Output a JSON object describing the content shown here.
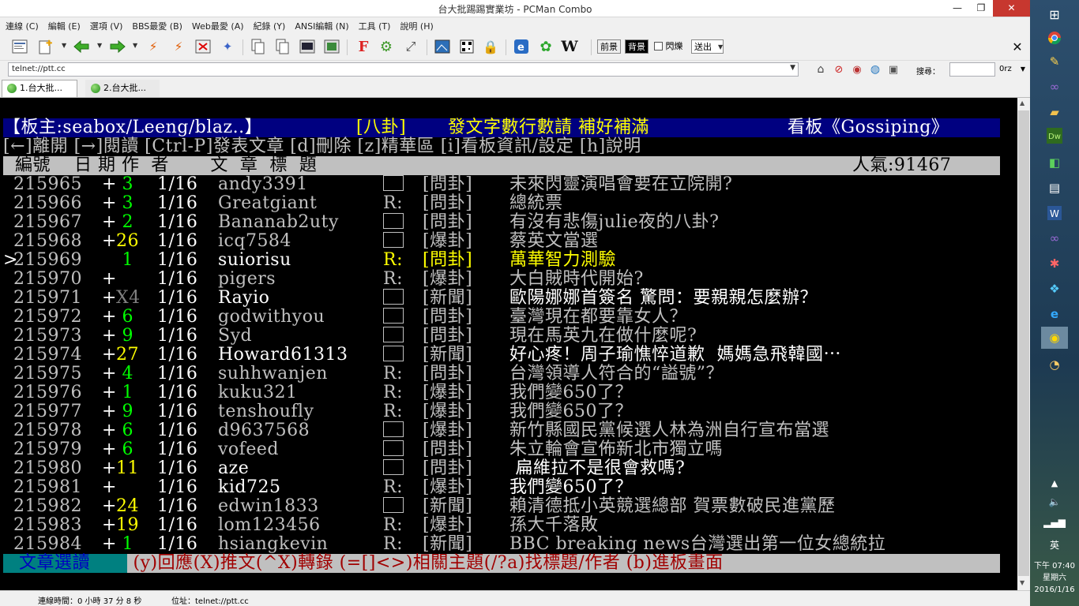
{
  "window": {
    "title": "台大批踢踢實業坊 - PCMan Combo",
    "min": "—",
    "max": "❐",
    "close": "✕"
  },
  "menu": [
    "連線 (C)",
    "編輯 (E)",
    "選項 (V)",
    "BBS最愛 (B)",
    "Web最愛 (A)",
    "紀錄 (Y)",
    "ANSI編輯 (N)",
    "工具 (T)",
    "說明 (H)"
  ],
  "toolbar": {
    "fg": "前景",
    "bg": "背景",
    "blink": "閃爍",
    "send": "送出",
    "close": "✕",
    "icons": [
      "new-connection-icon",
      "add-favorite-icon",
      "back-icon",
      "forward-icon",
      "reconnect-icon",
      "disconnect-icon",
      "close-connection-icon",
      "pin-icon",
      "copy-icon",
      "paste-icon",
      "copy-ansi-icon",
      "screenshot-icon",
      "font-icon",
      "settings-icon",
      "fullscreen-icon",
      "image-icon",
      "qrcode-icon",
      "lock-icon",
      "ie-icon",
      "flower-icon",
      "wikipedia-icon"
    ],
    "wiki": "W",
    "font": "F"
  },
  "address": {
    "value": "telnet://ptt.cc",
    "search_label": "搜尋：",
    "search_engine": "0rz"
  },
  "tabs": [
    {
      "label": "1.台大批..."
    },
    {
      "label": "2.台大批..."
    }
  ],
  "terminal": {
    "header": {
      "left": "【板主:seabox/Leeng/blaz..】",
      "board": "[八卦]",
      "title": "發文字數行數請 補好補滿",
      "right": "看板《Gossiping》"
    },
    "help": "[←]離開 [→]閱讀 [Ctrl-P]發表文章 [d]刪除 [z]精華區 [i]看板資訊/設定 [h]說明",
    "colhead": {
      "cols": "  編號    日 期 作  者       文  章  標  題",
      "popularity": "人氣:91467"
    },
    "rows": [
      {
        "cur": " ",
        "num": "215965",
        "mark": "+",
        "push": " 3",
        "pc": "g",
        "date": "1/16",
        "author": "andy3391",
        "re": "box",
        "cat": "[問卦]",
        "title": "未來閃靈演唱會要在立院開?"
      },
      {
        "cur": " ",
        "num": "215966",
        "mark": "+",
        "push": " 3",
        "pc": "g",
        "date": "1/16",
        "author": "Greatgiant",
        "re": "R:",
        "cat": "[問卦]",
        "title": "總統票"
      },
      {
        "cur": " ",
        "num": "215967",
        "mark": "+",
        "push": " 2",
        "pc": "g",
        "date": "1/16",
        "author": "Bananab2uty",
        "re": "box",
        "cat": "[問卦]",
        "title": "有沒有悲傷julie夜的八卦?"
      },
      {
        "cur": " ",
        "num": "215968",
        "mark": "+",
        "push": "26",
        "pc": "y",
        "date": "1/16",
        "author": "icq7584",
        "re": "box",
        "cat": "[爆卦]",
        "title": "蔡英文當選"
      },
      {
        "cur": ">",
        "num": "215969",
        "mark": " ",
        "push": " 1",
        "pc": "g",
        "date": "1/16",
        "author": "suiorisu",
        "re": "R:",
        "cat": "[問卦]",
        "title": "萬華智力測驗",
        "hl": true
      },
      {
        "cur": " ",
        "num": "215970",
        "mark": "+",
        "push": "  ",
        "pc": "g",
        "date": "1/16",
        "author": "pigers",
        "re": "R:",
        "cat": "[爆卦]",
        "title": "大白賊時代開始?"
      },
      {
        "cur": " ",
        "num": "215971",
        "mark": "+",
        "push": "X4",
        "pc": "gr",
        "date": "1/16",
        "author": "Rayio",
        "re": "box",
        "cat": "[新聞]",
        "title": "歐陽娜娜首簽名 驚問：要親親怎麼辦？",
        "bright": true
      },
      {
        "cur": " ",
        "num": "215972",
        "mark": "+",
        "push": " 6",
        "pc": "g",
        "date": "1/16",
        "author": "godwithyou",
        "re": "box",
        "cat": "[問卦]",
        "title": "臺灣現在都要靠女人？"
      },
      {
        "cur": " ",
        "num": "215973",
        "mark": "+",
        "push": " 9",
        "pc": "g",
        "date": "1/16",
        "author": "Syd",
        "re": "box",
        "cat": "[問卦]",
        "title": "現在馬英九在做什麼呢?"
      },
      {
        "cur": " ",
        "num": "215974",
        "mark": "+",
        "push": "27",
        "pc": "y",
        "date": "1/16",
        "author": "Howard61313",
        "re": "box",
        "cat": "[新聞]",
        "title": "好心疼！周子瑜憔悴道歉  媽媽急飛韓國⋯",
        "bright": true
      },
      {
        "cur": " ",
        "num": "215975",
        "mark": "+",
        "push": " 4",
        "pc": "g",
        "date": "1/16",
        "author": "suhhwanjen",
        "re": "R:",
        "cat": "[問卦]",
        "title": "台灣領導人符合的“謚號”？"
      },
      {
        "cur": " ",
        "num": "215976",
        "mark": "+",
        "push": " 1",
        "pc": "g",
        "date": "1/16",
        "author": "kuku321",
        "re": "R:",
        "cat": "[爆卦]",
        "title": "我們變650了？"
      },
      {
        "cur": " ",
        "num": "215977",
        "mark": "+",
        "push": " 9",
        "pc": "g",
        "date": "1/16",
        "author": "tenshoufly",
        "re": "R:",
        "cat": "[爆卦]",
        "title": "我們變650了？"
      },
      {
        "cur": " ",
        "num": "215978",
        "mark": "+",
        "push": " 6",
        "pc": "g",
        "date": "1/16",
        "author": "d9637568",
        "re": "box",
        "cat": "[爆卦]",
        "title": "新竹縣國民黨候選人林為洲自行宣布當選"
      },
      {
        "cur": " ",
        "num": "215979",
        "mark": "+",
        "push": " 6",
        "pc": "g",
        "date": "1/16",
        "author": "vofeed",
        "re": "box",
        "cat": "[問卦]",
        "title": "朱立輪會宣佈新北市獨立嗎"
      },
      {
        "cur": " ",
        "num": "215980",
        "mark": "+",
        "push": "11",
        "pc": "y",
        "date": "1/16",
        "author": "aze",
        "re": "box",
        "cat": "[問卦]",
        "title": " 扁維拉不是很會救嗎?",
        "bright": true
      },
      {
        "cur": " ",
        "num": "215981",
        "mark": "+",
        "push": "  ",
        "pc": "g",
        "date": "1/16",
        "author": "kid725",
        "re": "R:",
        "cat": "[爆卦]",
        "title": "我們變650了？",
        "bright": true
      },
      {
        "cur": " ",
        "num": "215982",
        "mark": "+",
        "push": "24",
        "pc": "y",
        "date": "1/16",
        "author": "edwin1833",
        "re": "box",
        "cat": "[新聞]",
        "title": "賴清德抵小英競選總部 賀票數破民進黨歷"
      },
      {
        "cur": " ",
        "num": "215983",
        "mark": "+",
        "push": "19",
        "pc": "y",
        "date": "1/16",
        "author": "lom123456",
        "re": "R:",
        "cat": "[爆卦]",
        "title": "孫大千落敗"
      },
      {
        "cur": " ",
        "num": "215984",
        "mark": "+",
        "push": " 1",
        "pc": "g",
        "date": "1/16",
        "author": "hsiangkevin",
        "re": "R:",
        "cat": "[新聞]",
        "title": "BBC breaking news台灣選出第一位女總統拉"
      }
    ],
    "footer": {
      "mode": "文章選讀",
      "keys": " (y)回應(X)推文(^X)轉錄 (=[]<>)相關主題(/?a)找標題/作者 (b)進板畫面"
    }
  },
  "status": {
    "conn": "連線時間：0 小時 37 分 8 秒",
    "addr": "位址：telnet://ptt.cc"
  },
  "taskbar": {
    "time": "下午 07:40",
    "day": "星期六",
    "date": "2016/1/16",
    "ime": "英"
  }
}
